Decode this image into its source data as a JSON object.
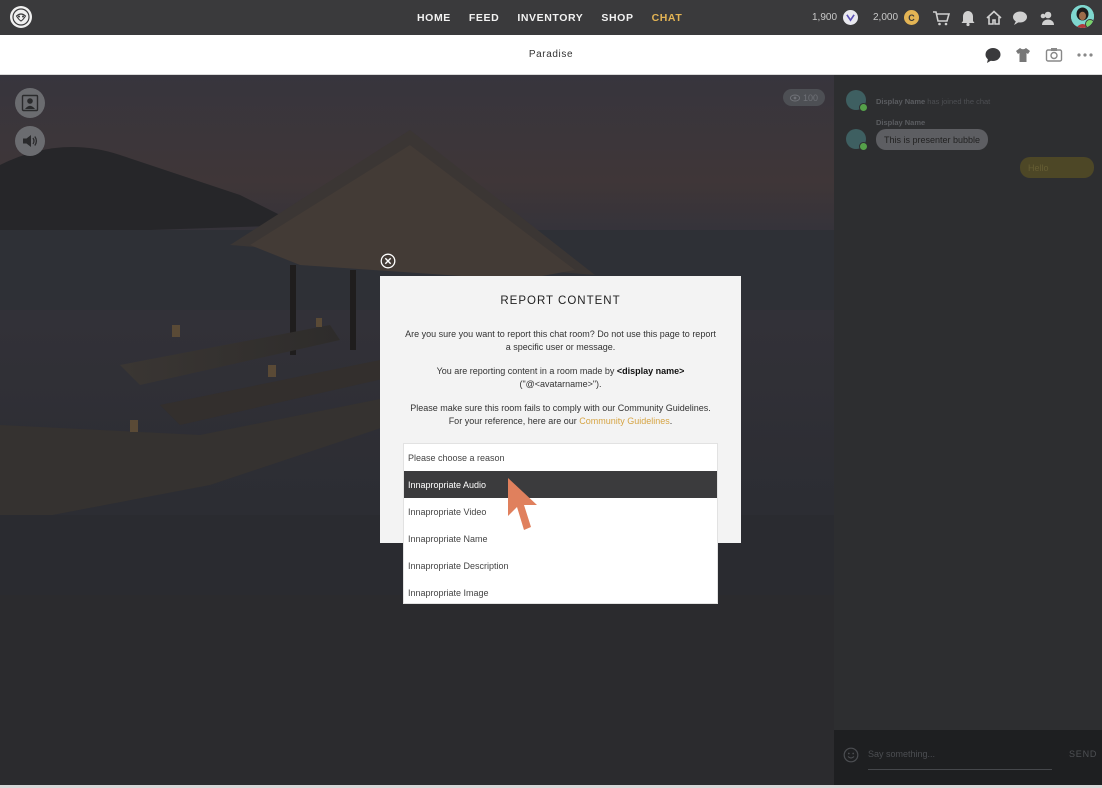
{
  "nav": {
    "links": [
      "HOME",
      "FEED",
      "INVENTORY",
      "SHOP",
      "CHAT"
    ],
    "active": "CHAT",
    "credits_value": "1,900",
    "credits_icon": "v-credit-icon",
    "coins_value": "2,000",
    "coins_icon_letter": "C",
    "icons": [
      "cart-icon",
      "bell-icon",
      "home-icon",
      "chat-bubbles-icon",
      "friends-icon",
      "profile-avatar"
    ]
  },
  "room": {
    "title": "Paradise",
    "icons": [
      "chat-bubble-icon",
      "shirt-icon",
      "camera-icon",
      "more-icon"
    ]
  },
  "scene": {
    "viewer_count": "100",
    "left_buttons": [
      "presenter-icon",
      "speaker-icon"
    ]
  },
  "chat": {
    "join_name": "Display Name",
    "join_text": "has joined the chat",
    "message_name": "Display Name",
    "message_text": "This is  presenter bubble",
    "own_message": "Hello",
    "input_placeholder": "Say something...",
    "send_label": "SEND"
  },
  "modal": {
    "title": "REPORT CONTENT",
    "para1": "Are you sure you want to report this chat room? Do not use this page to report a specific user or message.",
    "para2_prefix": "You are reporting content in a room made by ",
    "para2_bold": "<display name>",
    "para2_suffix": " (\"@<avatarname>\").",
    "para3": "Please make sure this room fails to comply with our Community Guidelines. For your reference, here are our ",
    "para3_link": "Community Guidelines",
    "para3_end": ".",
    "dropdown": {
      "placeholder": "Please choose a reason",
      "options": [
        "Innapropriate Audio",
        "Innapropriate Video",
        "Innapropriate Name",
        "Innapropriate Description",
        "Innapropriate Image"
      ],
      "highlighted": "Innapropriate Audio"
    }
  },
  "colors": {
    "nav_bg": "#3a3a3c",
    "accent": "#e3b454",
    "link": "#d6a545",
    "cursor": "#e0805d"
  }
}
